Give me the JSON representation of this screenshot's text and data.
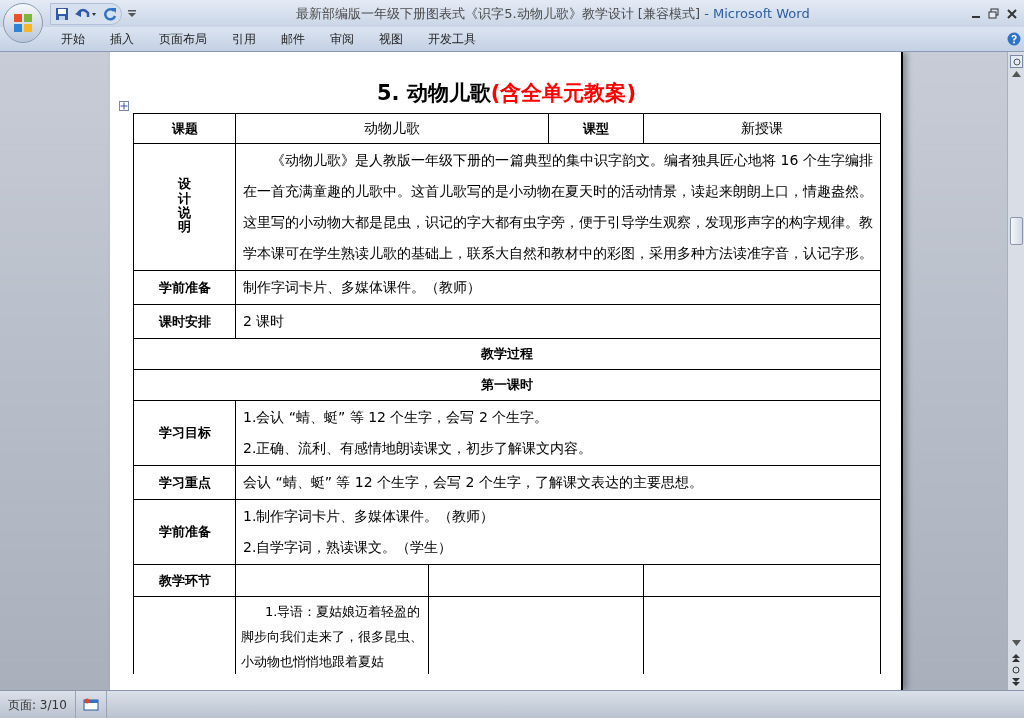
{
  "window": {
    "title": "最新部编版一年级下册图表式《识字5.动物儿歌》教学设计 [兼容模式]",
    "app": "- Microsoft Word"
  },
  "ribbon_tabs": [
    {
      "label": "开始"
    },
    {
      "label": "插入"
    },
    {
      "label": "页面布局"
    },
    {
      "label": "引用"
    },
    {
      "label": "邮件"
    },
    {
      "label": "审阅"
    },
    {
      "label": "视图"
    },
    {
      "label": "开发工具"
    }
  ],
  "document": {
    "title": "5. 动物儿歌",
    "title_note": "(含全单元教案)",
    "table": [
      {
        "kind": "header",
        "cells": [
          "课题",
          "动物儿歌",
          "课型",
          "新授课"
        ]
      },
      {
        "kind": "vertical",
        "label": "设计说明",
        "paragraphs": [
          "《动物儿歌》是人教版一年级下册的一篇典型的集中识字韵文。编者独具匠心地将 16 个生字编排在一首充满童趣的儿歌中。这首儿歌写的是小动物在夏天时的活动情景，读起来朗朗上口，情趣盎然。这里写的小动物大都是昆虫，识记的字大都有虫字旁，便于引导学生观察，发现形声字的构字规律。教学本课可在学生熟读儿歌的基础上，联系大自然和教材中的彩图，采用多种方法读准字音，认记字形。"
        ]
      },
      {
        "kind": "pair",
        "label": "学前准备",
        "paragraphs": [
          "制作字词卡片、多媒体课件。（教师）"
        ]
      },
      {
        "kind": "pair",
        "label": "课时安排",
        "paragraphs": [
          "2 课时"
        ]
      },
      {
        "kind": "span",
        "text": "教学过程"
      },
      {
        "kind": "span",
        "text": "第一课时"
      },
      {
        "kind": "pair",
        "label": "学习目标",
        "paragraphs": [
          "1.会认 “蜻、蜓” 等 12 个生字，会写 2 个生字。",
          "2.正确、流利、有感情地朗读课文，初步了解课文内容。"
        ]
      },
      {
        "kind": "pair",
        "label": "学习重点",
        "paragraphs": [
          "会认 “蜻、蜓” 等 12 个生字，会写 2 个生字，了解课文表达的主要思想。"
        ]
      },
      {
        "kind": "pair",
        "label": "学前准备",
        "paragraphs": [
          "1.制作字词卡片、多媒体课件。（教师）",
          "2.自学字词，熟读课文。（学生）"
        ]
      },
      {
        "kind": "steps",
        "label": "教学环节"
      },
      {
        "kind": "content",
        "text": "1.导语：夏姑娘迈着轻盈的脚步向我们走来了，很多昆虫、小动物也悄悄地跟着夏姑"
      }
    ]
  },
  "status_bar": {
    "page": "页面: 3/10"
  }
}
